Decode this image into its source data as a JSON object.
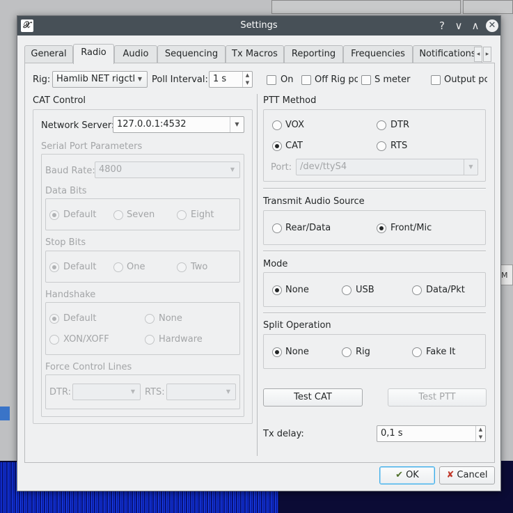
{
  "window": {
    "title": "Settings",
    "help": "?",
    "minimize": "∨",
    "maximize": "∧",
    "close": "✕",
    "app_icon": "𝒳"
  },
  "tabs": [
    {
      "label": "General"
    },
    {
      "label": "Radio"
    },
    {
      "label": "Audio"
    },
    {
      "label": "Sequencing"
    },
    {
      "label": "Tx Macros"
    },
    {
      "label": "Reporting"
    },
    {
      "label": "Frequencies"
    },
    {
      "label": "Notifications"
    }
  ],
  "tab_scroll": {
    "left": "◂",
    "right": "▸"
  },
  "rig_row": {
    "rig_label": "Rig:",
    "rig_value": "Hamlib NET rigctl",
    "poll_label": "Poll Interval:",
    "poll_value": "1 s",
    "on_label": "On",
    "off_rig_label": "Off Rig po",
    "s_meter_label": "S meter",
    "output_label": "Output pc"
  },
  "cat": {
    "title": "CAT Control",
    "network_label": "Network Server:",
    "network_value": "127.0.0.1:4532",
    "serial_title": "Serial Port Parameters",
    "baud_label": "Baud Rate:",
    "baud_value": "4800",
    "data_bits_title": "Data Bits",
    "data_bits": [
      "Default",
      "Seven",
      "Eight"
    ],
    "stop_bits_title": "Stop Bits",
    "stop_bits": [
      "Default",
      "One",
      "Two"
    ],
    "handshake_title": "Handshake",
    "handshake": [
      "Default",
      "None",
      "XON/XOFF",
      "Hardware"
    ],
    "force_title": "Force Control Lines",
    "dtr_label": "DTR:",
    "rts_label": "RTS:"
  },
  "ptt": {
    "title": "PTT Method",
    "vox": "VOX",
    "dtr": "DTR",
    "cat": "CAT",
    "rts": "RTS",
    "port_label": "Port:",
    "port_value": "/dev/ttyS4"
  },
  "audio_source": {
    "title": "Transmit Audio Source",
    "rear": "Rear/Data",
    "front": "Front/Mic"
  },
  "mode": {
    "title": "Mode",
    "none": "None",
    "usb": "USB",
    "data": "Data/Pkt"
  },
  "split": {
    "title": "Split Operation",
    "none": "None",
    "rig": "Rig",
    "fake": "Fake It"
  },
  "buttons": {
    "test_cat": "Test CAT",
    "test_ptt": "Test PTT",
    "ok": "OK",
    "cancel": "Cancel"
  },
  "tx_delay": {
    "label": "Tx delay:",
    "value": "0,1 s"
  },
  "background": {
    "right_tab": "nM"
  },
  "colors": {
    "titlebar": "#475057",
    "focus": "#3daee9",
    "waterfall": "#1435d8"
  }
}
